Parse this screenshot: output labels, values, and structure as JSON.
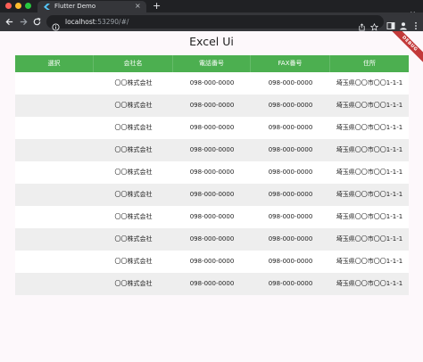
{
  "browser": {
    "tab_title": "Flutter Demo",
    "tab_close": "×",
    "new_tab": "+",
    "url_host": "localhost",
    "url_rest": ":53290/#/"
  },
  "app": {
    "title": "Excel Ui",
    "debug_banner": "DEBUG"
  },
  "table": {
    "columns": [
      "選択",
      "会社名",
      "電話番号",
      "FAX番号",
      "住所"
    ],
    "rows": [
      [
        "",
        "〇〇株式会社",
        "098-000-0000",
        "098-000-0000",
        "埼玉県〇〇市〇〇1-1-1"
      ],
      [
        "",
        "〇〇株式会社",
        "098-000-0000",
        "098-000-0000",
        "埼玉県〇〇市〇〇1-1-1"
      ],
      [
        "",
        "〇〇株式会社",
        "098-000-0000",
        "098-000-0000",
        "埼玉県〇〇市〇〇1-1-1"
      ],
      [
        "",
        "〇〇株式会社",
        "098-000-0000",
        "098-000-0000",
        "埼玉県〇〇市〇〇1-1-1"
      ],
      [
        "",
        "〇〇株式会社",
        "098-000-0000",
        "098-000-0000",
        "埼玉県〇〇市〇〇1-1-1"
      ],
      [
        "",
        "〇〇株式会社",
        "098-000-0000",
        "098-000-0000",
        "埼玉県〇〇市〇〇1-1-1"
      ],
      [
        "",
        "〇〇株式会社",
        "098-000-0000",
        "098-000-0000",
        "埼玉県〇〇市〇〇1-1-1"
      ],
      [
        "",
        "〇〇株式会社",
        "098-000-0000",
        "098-000-0000",
        "埼玉県〇〇市〇〇1-1-1"
      ],
      [
        "",
        "〇〇株式会社",
        "098-000-0000",
        "098-000-0000",
        "埼玉県〇〇市〇〇1-1-1"
      ],
      [
        "",
        "〇〇株式会社",
        "098-000-0000",
        "098-000-0000",
        "埼玉県〇〇市〇〇1-1-1"
      ]
    ]
  },
  "colors": {
    "header_green": "#4caf50",
    "row_alt": "#eeeeee",
    "page_bg": "#fdf8fb",
    "debug_red": "#c33a3a"
  },
  "icons": {
    "favicon": "flutter-logo-icon",
    "back": "arrow-left-icon",
    "forward": "arrow-right-icon",
    "reload": "reload-icon",
    "site_info": "info-icon",
    "share": "share-icon",
    "bookmark": "star-icon",
    "side_panel": "side-panel-icon",
    "profile": "person-icon",
    "menu": "kebab-menu-icon",
    "tab_search": "chevron-down-icon"
  }
}
